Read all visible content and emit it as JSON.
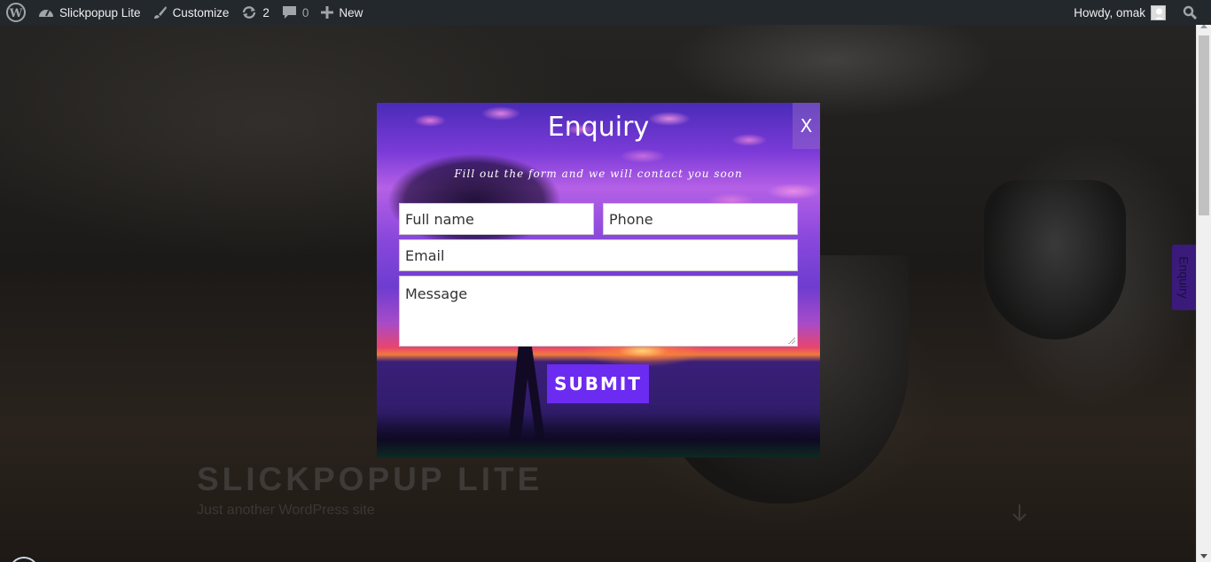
{
  "adminbar": {
    "site_name": "Slickpopup Lite",
    "customize": "Customize",
    "updates_count": "2",
    "comments_count": "0",
    "new_label": "New",
    "howdy": "Howdy, omak"
  },
  "site": {
    "title": "SLICKPOPUP LITE",
    "description": "Just another WordPress site",
    "side_tab": "Enquiry"
  },
  "modal": {
    "title": "Enquiry",
    "close_label": "X",
    "subtitle": "Fill out the form and we will contact you soon",
    "fields": {
      "name_placeholder": "Full name",
      "phone_placeholder": "Phone",
      "email_placeholder": "Email",
      "message_placeholder": "Message"
    },
    "submit_label": "SUBMIT"
  }
}
